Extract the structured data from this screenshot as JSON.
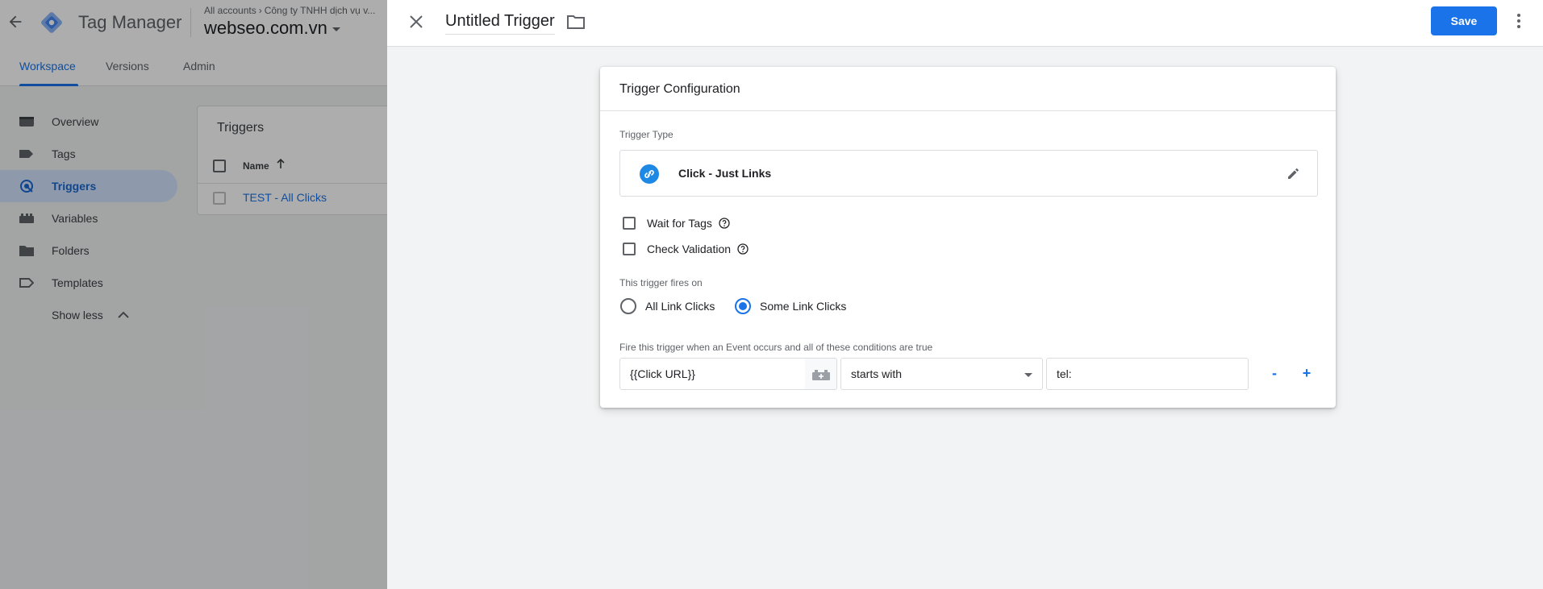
{
  "app": {
    "product_name": "Tag Manager",
    "breadcrumb": [
      "All accounts",
      "Công ty TNHH dịch vụ v..."
    ],
    "container_name": "webseo.com.vn",
    "nav_tabs": [
      "Workspace",
      "Versions",
      "Admin"
    ],
    "active_tab": "Workspace",
    "sidebar": [
      {
        "label": "Overview",
        "icon": "overview-icon"
      },
      {
        "label": "Tags",
        "icon": "tag-icon"
      },
      {
        "label": "Triggers",
        "icon": "trigger-icon",
        "active": true
      },
      {
        "label": "Variables",
        "icon": "variables-icon"
      },
      {
        "label": "Folders",
        "icon": "folder-icon"
      },
      {
        "label": "Templates",
        "icon": "template-icon"
      }
    ],
    "show_less": "Show less",
    "triggers_panel": {
      "title": "Triggers",
      "column_name": "Name",
      "rows": [
        "TEST - All Clicks"
      ]
    }
  },
  "sheet": {
    "title": "Untitled Trigger",
    "save_label": "Save",
    "card_title": "Trigger Configuration",
    "trigger_type_label": "Trigger Type",
    "trigger_type_name": "Click - Just Links",
    "wait_for_tags": {
      "label": "Wait for Tags",
      "checked": false
    },
    "check_validation": {
      "label": "Check Validation",
      "checked": false
    },
    "fires_on_label": "This trigger fires on",
    "fires_on_options": [
      "All Link Clicks",
      "Some Link Clicks"
    ],
    "fires_on_selected": "Some Link Clicks",
    "conditions_label": "Fire this trigger when an Event occurs and all of these conditions are true",
    "condition": {
      "variable": "{{Click URL}}",
      "operator": "starts with",
      "value": "tel:"
    },
    "remove_label": "-",
    "add_label": "+"
  },
  "colors": {
    "accent": "#1a73e8",
    "selected_bg": "#d2e3fc",
    "type_icon": "#1e88e5"
  }
}
